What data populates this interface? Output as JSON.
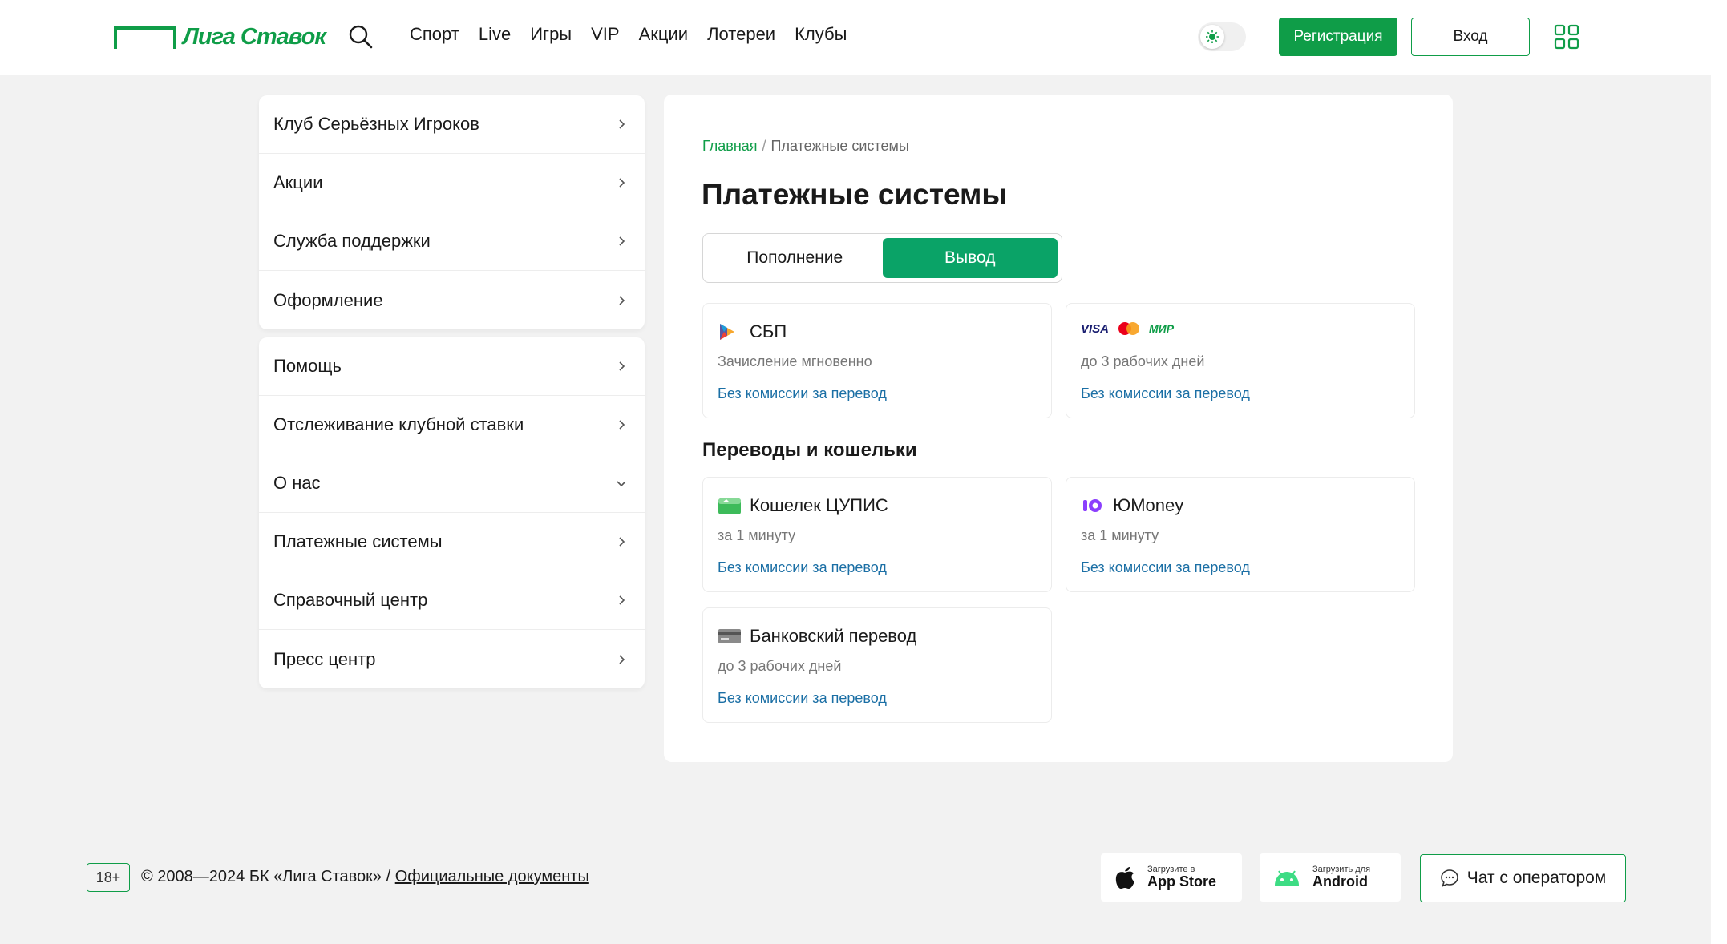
{
  "header": {
    "logo_text": "Лига Ставок",
    "nav": [
      "Спорт",
      "Live",
      "Игры",
      "VIP",
      "Акции",
      "Лотереи",
      "Клубы"
    ],
    "register_label": "Регистрация",
    "login_label": "Вход"
  },
  "sidebar": {
    "group1": [
      "Клуб Серьёзных Игроков",
      "Акции",
      "Служба поддержки",
      "Оформление"
    ],
    "group2": [
      "Помощь",
      "Отслеживание клубной ставки",
      "О нас",
      "Платежные системы",
      "Справочный центр",
      "Пресс центр"
    ]
  },
  "main": {
    "breadcrumb_home": "Главная",
    "breadcrumb_sep": "/",
    "breadcrumb_current": "Платежные системы",
    "title": "Платежные системы",
    "tab_deposit": "Пополнение",
    "tab_withdraw": "Вывод",
    "section_wallets": "Переводы и кошельки",
    "cards": [
      {
        "name": "СБП",
        "time": "Зачисление мгновенно",
        "fee": "Без комиссии за перевод",
        "icon": "sbp-icon"
      },
      {
        "name": "",
        "time": "до 3 рабочих дней",
        "fee": "Без комиссии за перевод",
        "icon": "bank-cards-icon",
        "logos": [
          "VISA",
          "МИР"
        ]
      },
      {
        "name": "Кошелек ЦУПИС",
        "time": "за 1 минуту",
        "fee": "Без комиссии за перевод",
        "icon": "wallet-icon"
      },
      {
        "name": "ЮMoney",
        "time": "за 1 минуту",
        "fee": "Без комиссии за перевод",
        "icon": "yoomoney-icon"
      },
      {
        "name": "Банковский перевод",
        "time": "до 3 рабочих дней",
        "fee": "Без комиссии за перевод",
        "icon": "bank-card-icon"
      }
    ]
  },
  "footer": {
    "age": "18+",
    "copyright": "© 2008—2024 БК «Лига Ставок» /",
    "docs": "Официальные документы",
    "appstore_small": "Загрузите в",
    "appstore_big": "App Store",
    "android_small": "Загрузить для",
    "android_big": "Android",
    "chat_label": "Чат с оператором"
  },
  "colors": {
    "brand": "#0f9d48",
    "tab_active": "#0aa367",
    "link": "#1b6fa5"
  }
}
